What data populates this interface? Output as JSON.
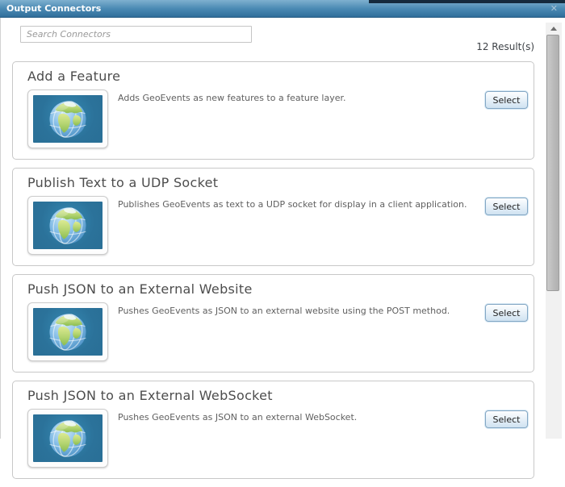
{
  "titlebar": {
    "title": "Output Connectors",
    "close_icon": "✕"
  },
  "search": {
    "placeholder": "Search Connectors"
  },
  "results_count": "12 Result(s)",
  "connectors": [
    {
      "title": "Add a Feature",
      "description": "Adds GeoEvents as new features to a feature layer.",
      "button": "Select"
    },
    {
      "title": "Publish Text to a UDP Socket",
      "description": "Publishes GeoEvents as text to a UDP socket for display in a client application.",
      "button": "Select"
    },
    {
      "title": "Push JSON to an External Website",
      "description": "Pushes GeoEvents as JSON to an external website using the POST method.",
      "button": "Select"
    },
    {
      "title": "Push JSON to an External WebSocket",
      "description": "Pushes GeoEvents as JSON to an external WebSocket.",
      "button": "Select"
    }
  ],
  "icons": {
    "close": "x-close",
    "scroll_up": "up-arrow-triangle",
    "thumbnail": "earth-globe"
  },
  "colors": {
    "titlebar_gradient_top": "#7fb0cf",
    "titlebar_gradient_bottom": "#306e9a",
    "page_strip": "#152a3d",
    "card_border": "#c8c8c8",
    "button_border": "#84a7c4",
    "button_gradient_bottom": "#cfe2f1",
    "thumbnail_background": "#2e7da4",
    "ocean_blue": "#83bce6",
    "land_green": "#a5cc68"
  }
}
